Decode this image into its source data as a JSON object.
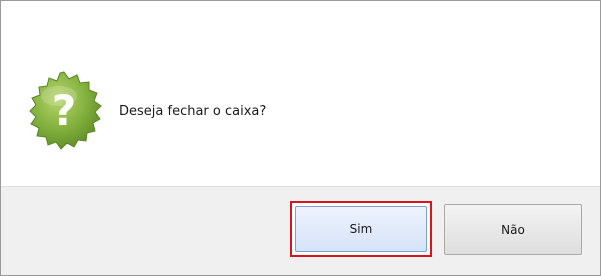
{
  "dialog": {
    "message": "Deseja fechar o caixa?",
    "icon": "question-badge-icon",
    "buttons": {
      "yes_label": "Sim",
      "no_label": "Não"
    }
  },
  "colors": {
    "icon_green": "#7aa83a",
    "focus_outline": "#d9141c",
    "footer_bg": "#f0f0f0"
  }
}
